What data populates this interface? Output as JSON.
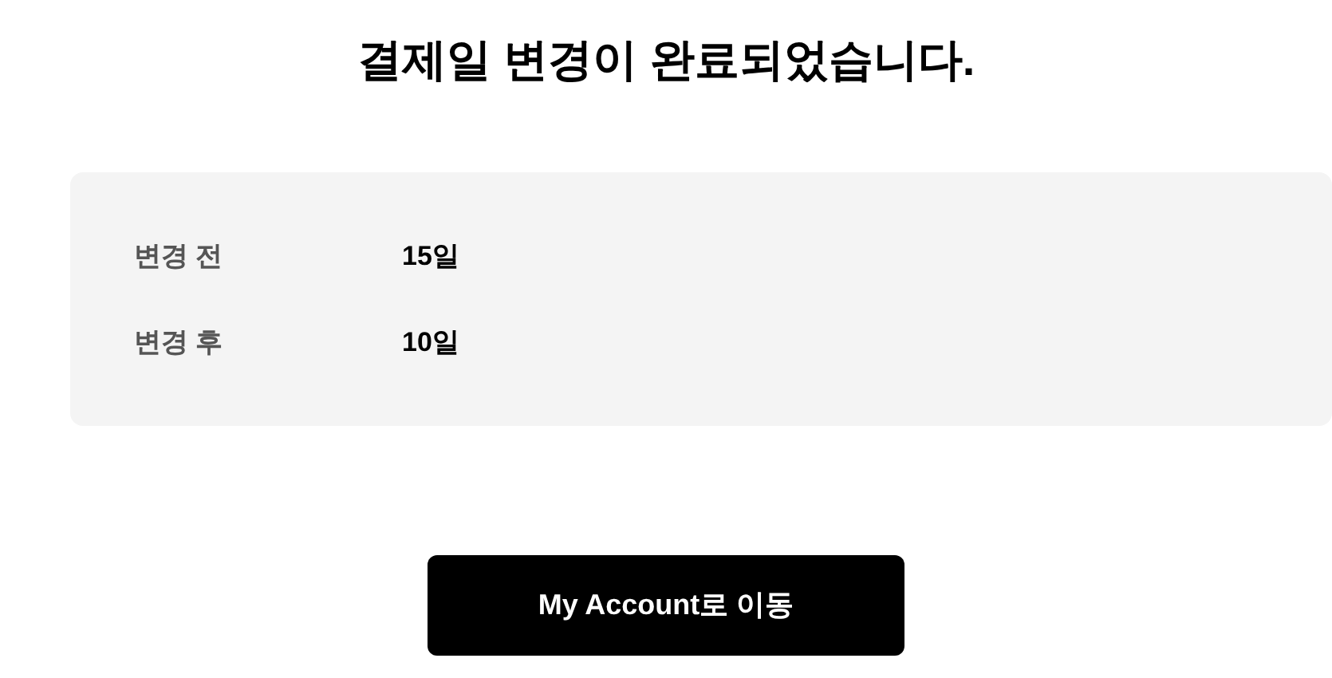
{
  "title": "결제일 변경이 완료되었습니다.",
  "details": [
    {
      "label": "변경 전",
      "value": "15일"
    },
    {
      "label": "변경 후",
      "value": "10일"
    }
  ],
  "button": {
    "label": "My Account로 이동"
  }
}
